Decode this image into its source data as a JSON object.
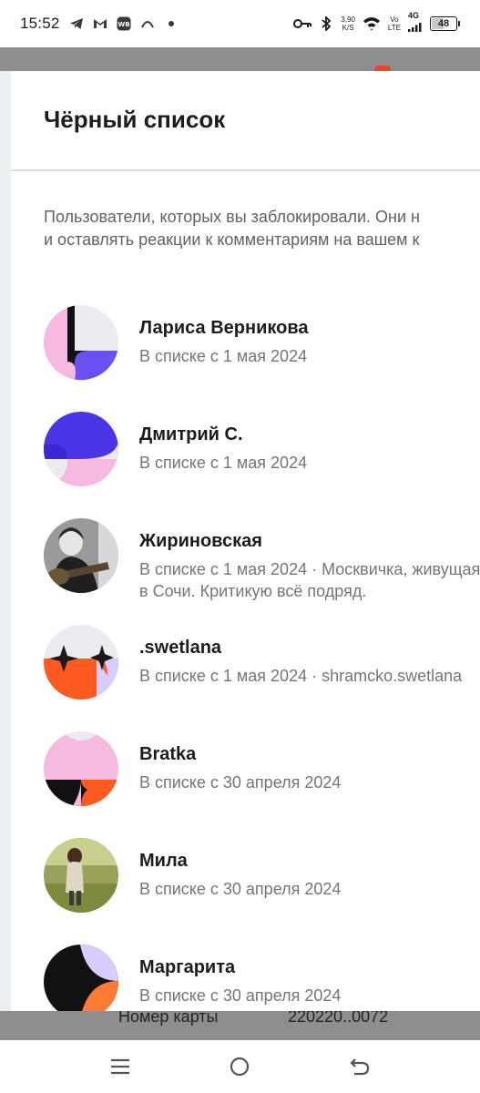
{
  "status_bar": {
    "time": "15:52",
    "speed_value": "3,90",
    "speed_unit": "K/S",
    "volte_top": "Vo",
    "volte_bottom": "LTE",
    "network": "4G",
    "battery": "48",
    "battery_level": 0.48
  },
  "underlay": {
    "card_label": "Номер карты",
    "card_number": "220220..0072"
  },
  "sheet": {
    "title": "Чёрный список",
    "description_line1": "Пользователи, которых вы заблокировали. Они н",
    "description_line2": "и оставлять реакции к комментариям на вашем к"
  },
  "users": [
    {
      "name": "Лариса Верникова",
      "sub": "В списке с 1 мая 2024",
      "avatar": "lavender-pink-black-pattern"
    },
    {
      "name": "Дмитрий С.",
      "sub": "В списке с 1 мая 2024",
      "avatar": "blue-pink-pattern"
    },
    {
      "name": "Жириновская",
      "sub": "В списке с 1 мая 2024 · Москвичка, живущая в Сочи. Критикую всё подряд.",
      "avatar": "photo-woman-guitar"
    },
    {
      "name": ".swetlana",
      "sub": "В списке с 1 мая 2024 · shramcko.swetlana",
      "avatar": "orange-sparkle-pattern"
    },
    {
      "name": "Bratka",
      "sub": "В списке с 30 апреля 2024",
      "avatar": "pink-orange-black-pattern"
    },
    {
      "name": "Мила",
      "sub": "В списке с 30 апреля 2024",
      "avatar": "photo-girl-field"
    },
    {
      "name": "Маргарита",
      "sub": "В списке с 30 апреля 2024",
      "avatar": "black-lavender-orange-pattern"
    }
  ],
  "nav": {
    "menu": "menu-icon",
    "home": "home-icon",
    "back": "back-icon"
  }
}
